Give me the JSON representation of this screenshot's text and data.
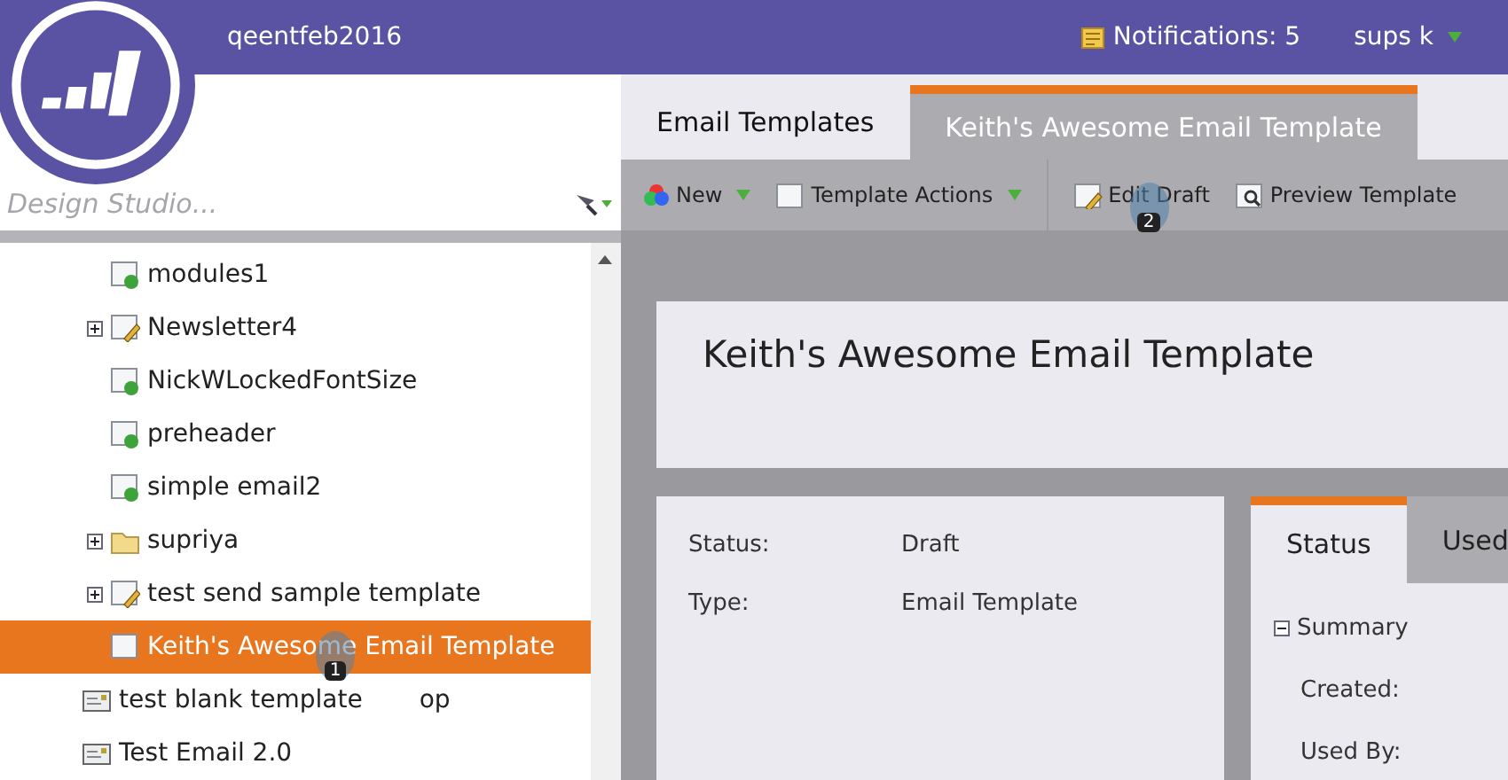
{
  "header": {
    "workspace": "qeentfeb2016",
    "notifications": "Notifications: 5",
    "user": "sups k"
  },
  "sidebar": {
    "search": {
      "placeholder": "Design Studio..."
    },
    "tree": [
      {
        "kind": "group",
        "children": [
          {
            "label": "modules1",
            "kind": "approved",
            "expandable": false,
            "selected": false
          },
          {
            "label": "Newsletter4",
            "kind": "draft",
            "expandable": true,
            "selected": false
          },
          {
            "label": "NickWLockedFontSize",
            "kind": "approved",
            "expandable": false,
            "selected": false
          },
          {
            "label": "preheader",
            "kind": "approved",
            "expandable": false,
            "selected": false
          },
          {
            "label": "simple email2",
            "kind": "approved",
            "expandable": false,
            "selected": false
          },
          {
            "label": "supriya",
            "kind": "folder",
            "expandable": true,
            "selected": false
          },
          {
            "label": "test send sample template",
            "kind": "draft",
            "expandable": true,
            "selected": false
          },
          {
            "label": "Keith's Awesome Email Template",
            "kind": "blank",
            "expandable": false,
            "selected": true
          }
        ]
      },
      {
        "kind": "email",
        "label_parts": [
          "test blank template",
          "op"
        ],
        "selected": false
      },
      {
        "kind": "email",
        "label_parts": [
          "Test Email 2.0"
        ],
        "selected": false
      }
    ]
  },
  "tabs": [
    {
      "label": "Email Templates",
      "selected": false
    },
    {
      "label": "Keith's Awesome Email Template",
      "selected": true
    }
  ],
  "toolbar": [
    {
      "label": "New",
      "kind": "colors",
      "dropdown": true
    },
    {
      "label": "Template Actions",
      "kind": "blank",
      "dropdown": true
    },
    {
      "label": "Edit Draft",
      "kind": "draft",
      "dropdown": false
    },
    {
      "label": "Preview Template",
      "kind": "preview",
      "dropdown": false
    }
  ],
  "title": "Keith's Awesome Email Template",
  "details": [
    {
      "label": "Status:",
      "value": "Draft"
    },
    {
      "label": "Type:",
      "value": "Email Template"
    }
  ],
  "status_panel": {
    "tabs": [
      {
        "label": "Status",
        "selected": true
      },
      {
        "label": "Used",
        "selected": false
      }
    ],
    "section": "Summary",
    "fields": [
      "Created:",
      "Used By:"
    ]
  },
  "callouts": [
    "1",
    "2"
  ]
}
